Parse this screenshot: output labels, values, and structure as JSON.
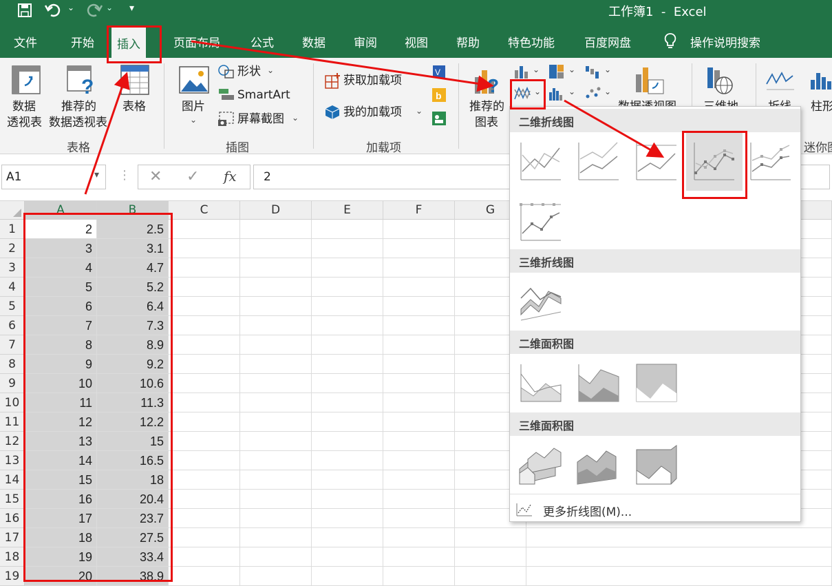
{
  "title_bar": {
    "title": "工作簿1  -  Excel",
    "bg_color": "#217346",
    "icons": [
      "save-icon",
      "undo-icon",
      "redo-icon",
      "customize-qat-icon"
    ]
  },
  "tabs": [
    {
      "label": "文件"
    },
    {
      "label": "开始"
    },
    {
      "label": "插入",
      "active": true
    },
    {
      "label": "页面布局"
    },
    {
      "label": "公式"
    },
    {
      "label": "数据"
    },
    {
      "label": "审阅"
    },
    {
      "label": "视图"
    },
    {
      "label": "帮助"
    },
    {
      "label": "特色功能"
    },
    {
      "label": "百度网盘"
    },
    {
      "label": "操作说明搜索"
    }
  ],
  "ribbon": {
    "tables_group": {
      "label": "表格",
      "pivot_label_line1": "数据",
      "pivot_label_line2": "透视表",
      "rec_pivot_line1": "推荐的",
      "rec_pivot_line2": "数据透视表",
      "table_label": "表格"
    },
    "illustrations_group": {
      "label": "插图",
      "picture_label": "图片",
      "shapes_label": "形状",
      "smartart_label": "SmartArt",
      "screenshot_label": "屏幕截图"
    },
    "addins_group": {
      "label": "加载项",
      "get_addins": "获取加载项",
      "my_addins": "我的加载项"
    },
    "charts_group": {
      "rec_charts_line1": "推荐的",
      "rec_charts_line2": "图表",
      "pivot_chart": "数据透视图",
      "map3d": "三维地",
      "sparkline_line": "折线",
      "sparkline_column": "柱形",
      "sparkline_group": "迷你图"
    }
  },
  "formula_bar": {
    "name_box": "A1",
    "fx_label": "fx",
    "value": "2"
  },
  "grid": {
    "columns": [
      "A",
      "B",
      "C",
      "D",
      "E",
      "F",
      "G"
    ],
    "rows": [
      {
        "n": "1",
        "a": "2",
        "b": "2.5"
      },
      {
        "n": "2",
        "a": "3",
        "b": "3.1"
      },
      {
        "n": "3",
        "a": "4",
        "b": "4.7"
      },
      {
        "n": "4",
        "a": "5",
        "b": "5.2"
      },
      {
        "n": "5",
        "a": "6",
        "b": "6.4"
      },
      {
        "n": "6",
        "a": "7",
        "b": "7.3"
      },
      {
        "n": "7",
        "a": "8",
        "b": "8.9"
      },
      {
        "n": "8",
        "a": "9",
        "b": "9.2"
      },
      {
        "n": "9",
        "a": "10",
        "b": "10.6"
      },
      {
        "n": "10",
        "a": "11",
        "b": "11.3"
      },
      {
        "n": "11",
        "a": "12",
        "b": "12.2"
      },
      {
        "n": "12",
        "a": "13",
        "b": "15"
      },
      {
        "n": "13",
        "a": "14",
        "b": "16.5"
      },
      {
        "n": "14",
        "a": "15",
        "b": "18"
      },
      {
        "n": "15",
        "a": "16",
        "b": "20.4"
      },
      {
        "n": "16",
        "a": "17",
        "b": "23.7"
      },
      {
        "n": "17",
        "a": "18",
        "b": "27.5"
      },
      {
        "n": "18",
        "a": "19",
        "b": "33.4"
      },
      {
        "n": "19",
        "a": "20",
        "b": "38.9"
      }
    ]
  },
  "dropdown": {
    "sections": [
      {
        "label": "二维折线图"
      },
      {
        "label": "三维折线图"
      },
      {
        "label": "二维面积图"
      },
      {
        "label": "三维面积图"
      }
    ],
    "more_label": "更多折线图(M)..."
  },
  "annotation_color": "#e81010"
}
